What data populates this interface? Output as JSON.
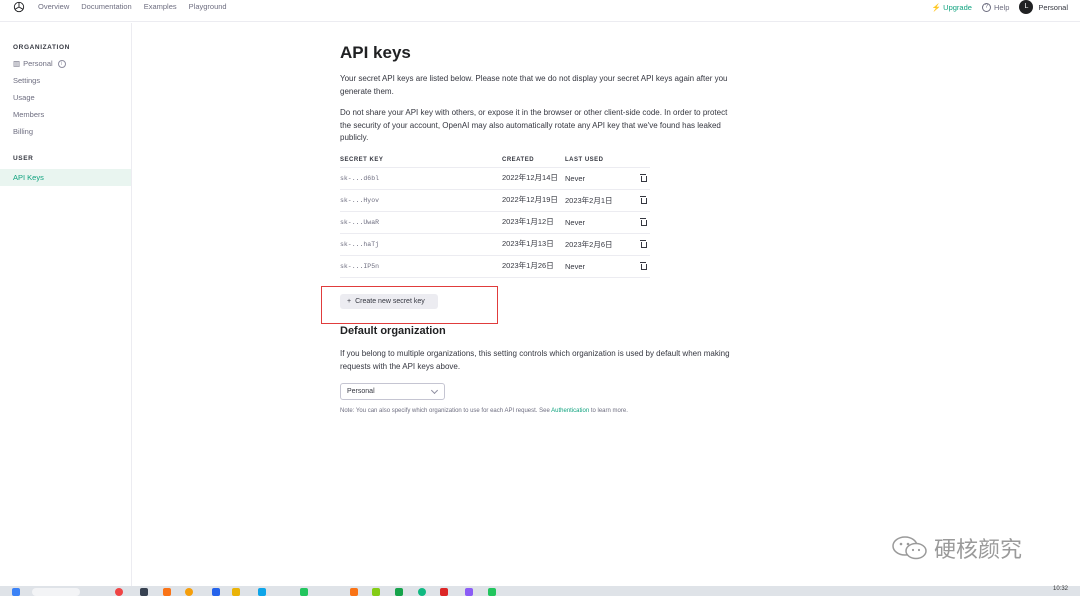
{
  "topnav": {
    "links": [
      "Overview",
      "Documentation",
      "Examples",
      "Playground"
    ],
    "upgrade": "Upgrade",
    "help": "Help",
    "avatar_letter": "L",
    "user": "Personal"
  },
  "sidebar": {
    "org_heading": "ORGANIZATION",
    "org_name": "Personal",
    "org_items": [
      "Settings",
      "Usage",
      "Members",
      "Billing"
    ],
    "user_heading": "USER",
    "active_item": "API Keys"
  },
  "main": {
    "title": "API keys",
    "intro": "Your secret API keys are listed below. Please note that we do not display your secret API keys again after you generate them.",
    "warning": "Do not share your API key with others, or expose it in the browser or other client-side code. In order to protect the security of your account, OpenAI may also automatically rotate any API key that we've found has leaked publicly.",
    "table": {
      "headers": [
        "SECRET KEY",
        "CREATED",
        "LAST USED"
      ],
      "rows": [
        {
          "key": "sk-...d6bl",
          "created": "2022年12月14日",
          "last_used": "Never"
        },
        {
          "key": "sk-...Hyov",
          "created": "2022年12月19日",
          "last_used": "2023年2月1日"
        },
        {
          "key": "sk-...UwaR",
          "created": "2023年1月12日",
          "last_used": "Never"
        },
        {
          "key": "sk-...haTj",
          "created": "2023年1月13日",
          "last_used": "2023年2月6日"
        },
        {
          "key": "sk-...IP5n",
          "created": "2023年1月26日",
          "last_used": "Never"
        }
      ]
    },
    "create_button": "Create new secret key",
    "default_org_title": "Default organization",
    "default_org_text": "If you belong to multiple organizations, this setting controls which organization is used by default when making requests with the API keys above.",
    "select_value": "Personal",
    "note_prefix": "Note: You can also specify which organization to use for each API request. See ",
    "note_link": "Authentication",
    "note_suffix": " to learn more."
  },
  "watermark": "硬核颜究",
  "taskbar": {
    "clock": "10:32"
  },
  "colors": {
    "accent": "#10a37f",
    "highlight": "#e03c3c"
  }
}
